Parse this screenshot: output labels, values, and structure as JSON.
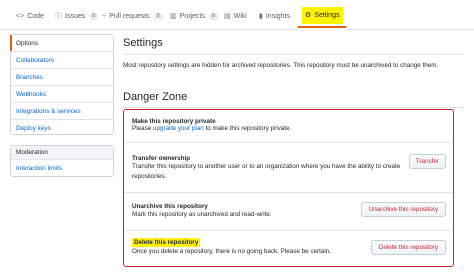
{
  "tabs": [
    {
      "label": "Code",
      "icon": "code-icon",
      "glyph": "<>"
    },
    {
      "label": "Issues",
      "icon": "issue-icon",
      "glyph": "ⓘ",
      "count": "0"
    },
    {
      "label": "Pull requests",
      "icon": "pull-request-icon",
      "glyph": "⑂",
      "count": "0"
    },
    {
      "label": "Projects",
      "icon": "project-icon",
      "glyph": "▥",
      "count": "0"
    },
    {
      "label": "Wiki",
      "icon": "wiki-icon",
      "glyph": "▤"
    },
    {
      "label": "Insights",
      "icon": "insights-icon",
      "glyph": "▮"
    },
    {
      "label": "Settings",
      "icon": "gear-icon",
      "glyph": "⚙",
      "selected": true
    }
  ],
  "sidebar": {
    "options": [
      {
        "label": "Options",
        "selected": true
      },
      {
        "label": "Collaborators"
      },
      {
        "label": "Branches"
      },
      {
        "label": "Webhooks"
      },
      {
        "label": "Integrations & services"
      },
      {
        "label": "Deploy keys"
      }
    ],
    "moderation": {
      "heading": "Moderation",
      "items": [
        {
          "label": "Interaction limits"
        }
      ]
    }
  },
  "settings": {
    "title": "Settings",
    "notice": "Most repository settings are hidden for archived repositories. This repository must be unarchived to change them."
  },
  "danger_zone": {
    "title": "Danger Zone",
    "items": [
      {
        "title": "Make this repository private",
        "desc_prefix": "Please ",
        "desc_link": "upgrade your plan",
        "desc_suffix": " to make this repository private."
      },
      {
        "title": "Transfer ownership",
        "desc_line1": "Transfer this repository to another user or to an organization where you have the ability to create",
        "desc_line2": "repositories.",
        "button": "Transfer"
      },
      {
        "title": "Unarchive this repository",
        "desc_line1": "Mark this repository as unarchived and read-write.",
        "button": "Unarchive this repository"
      },
      {
        "title": "Delete this repository",
        "desc_line1": "Once you delete a repository, there is no going back. Please be certain.",
        "button": "Delete this repository"
      }
    ]
  },
  "colors": {
    "danger": "#cb2431",
    "link": "#0366d6",
    "highlight": "#fff200",
    "selected_accent": "#e36209"
  }
}
